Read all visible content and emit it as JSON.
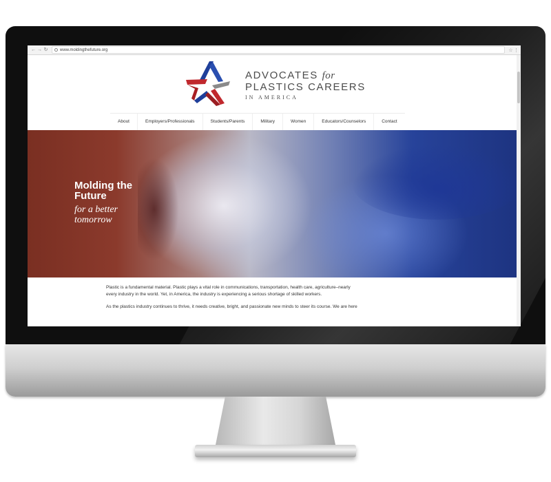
{
  "browser": {
    "url": "www.moldingthefuture.org",
    "back_icon": "back-arrow-icon",
    "forward_icon": "forward-arrow-icon",
    "reload_icon": "reload-icon"
  },
  "logo": {
    "line1_main": "ADVOCATES",
    "line1_italic": "for",
    "line2": "PLASTICS CAREERS",
    "line3": "IN AMERICA",
    "colors": {
      "red": "#c0282d",
      "blue": "#1f3f9a",
      "gray": "#8a8a8a"
    }
  },
  "nav": {
    "items": [
      "About",
      "Employers/Professionals",
      "Students/Parents",
      "Military",
      "Women",
      "Educators/Counselors",
      "Contact"
    ]
  },
  "hero": {
    "title_line1": "Molding the",
    "title_line2": "Future",
    "subtitle_line1": "for a better",
    "subtitle_line2": "tomorrow"
  },
  "content": {
    "para1_line1": "Plastic is a fundamental material. Plastic plays a vital role in communications, transportation, health care, agriculture–nearly",
    "para1_line2": "every industry in the world. Yet, in America, the industry is experiencing a serious shortage of skilled workers.",
    "para2_line1": "As the plastics industry continues to thrive, it needs creative, bright, and passionate new minds to steer its course. We are here"
  }
}
